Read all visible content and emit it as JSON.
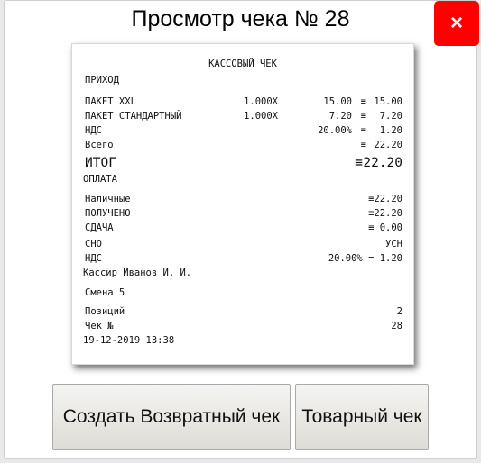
{
  "dialog": {
    "title": "Просмотр чека № 28",
    "close_label": "×"
  },
  "receipt": {
    "header": "КАССОВЫЙ ЧЕК",
    "operation": "ПРИХОД",
    "items": [
      {
        "name": "ПАКЕТ XXL",
        "qty": "1.000",
        "mult": "X",
        "price": "15.00",
        "eq": "≡",
        "total": "15.00"
      },
      {
        "name": "ПАКЕТ СТАНДАРТНЫЙ",
        "qty": "1.000",
        "mult": "X",
        "price": "7.20",
        "eq": "≡",
        "total": "7.20"
      }
    ],
    "vat_label": "НДС",
    "vat_rate": "20.00%",
    "vat_eq": "≡",
    "vat_amount": "1.20",
    "total_label": "Всего",
    "total_eq": "≡",
    "total_value": "22.20",
    "itog_label": "ИТОГ",
    "itog_eq": "≡",
    "itog_value": "22.20",
    "payment_header": "ОПЛАТА",
    "cash_label": "Наличные",
    "cash_value": "≡22.20",
    "received_label": "ПОЛУЧЕНО",
    "received_value": "≡22.20",
    "change_label": "СДАЧА",
    "change_value": "≡ 0.00",
    "sno_label": "СНО",
    "sno_value": "УСН",
    "vat2_label": "НДС",
    "vat2_value": "20.00% = 1.20",
    "cashier": "Кассир Иванов И. И.",
    "shift": "Смена 5",
    "positions_label": "Позиций",
    "positions_value": "2",
    "check_label": "Чек №",
    "check_value": "28",
    "datetime": "19-12-2019 13:38"
  },
  "buttons": {
    "return_label": "Создать Возвратный чек",
    "goods_label": "Товарный чек"
  },
  "colors": {
    "close_bg": "#ff0000",
    "button_bg": "#e6e4df"
  }
}
